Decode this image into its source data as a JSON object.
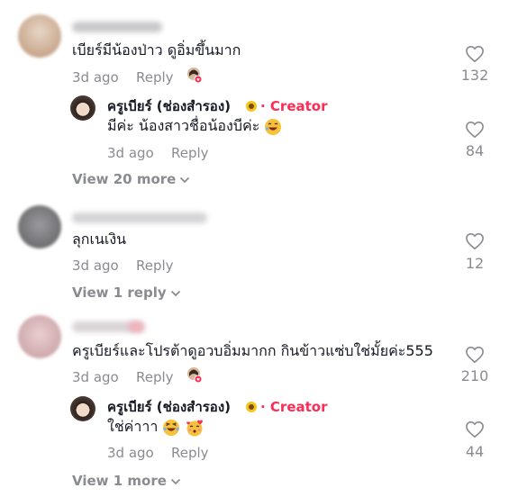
{
  "comments": [
    {
      "text": "เบียร์มีน้องป่าว ดูอิ่มขึ้นมาก",
      "time": "3d ago",
      "reply_label": "Reply",
      "likes": "132",
      "view_more": "View 20 more",
      "reply": {
        "username": "ครูเบียร์ (ช่องสำรอง)",
        "badge": "· Creator",
        "text": "มีค่ะ น้องสาวชื่อน้องบีค่ะ",
        "time": "3d ago",
        "reply_label": "Reply",
        "likes": "84"
      }
    },
    {
      "text": "ลุกเนเงิน",
      "time": "3d ago",
      "reply_label": "Reply",
      "likes": "12",
      "view_more": "View 1 reply"
    },
    {
      "text": "ครูเบียร์และโปรต้าดูอวบอิ่มมากก กินข้าวแซ่บใช่มั้ยค่ะ555",
      "time": "3d ago",
      "reply_label": "Reply",
      "likes": "210",
      "view_more": "View 1 more",
      "reply": {
        "username": "ครูเบียร์ (ช่องสำรอง)",
        "badge": "· Creator",
        "text": "ใช่ค่าาา",
        "time": "3d ago",
        "reply_label": "Reply",
        "likes": "44"
      }
    }
  ],
  "colors": {
    "creator": "#fe2c55",
    "muted": "#8a8b91",
    "text": "#161823"
  },
  "icons": [
    "heart-outline-icon",
    "chevron-down-icon",
    "sunflower-icon",
    "laughing-emoji",
    "kiss-emoji"
  ]
}
